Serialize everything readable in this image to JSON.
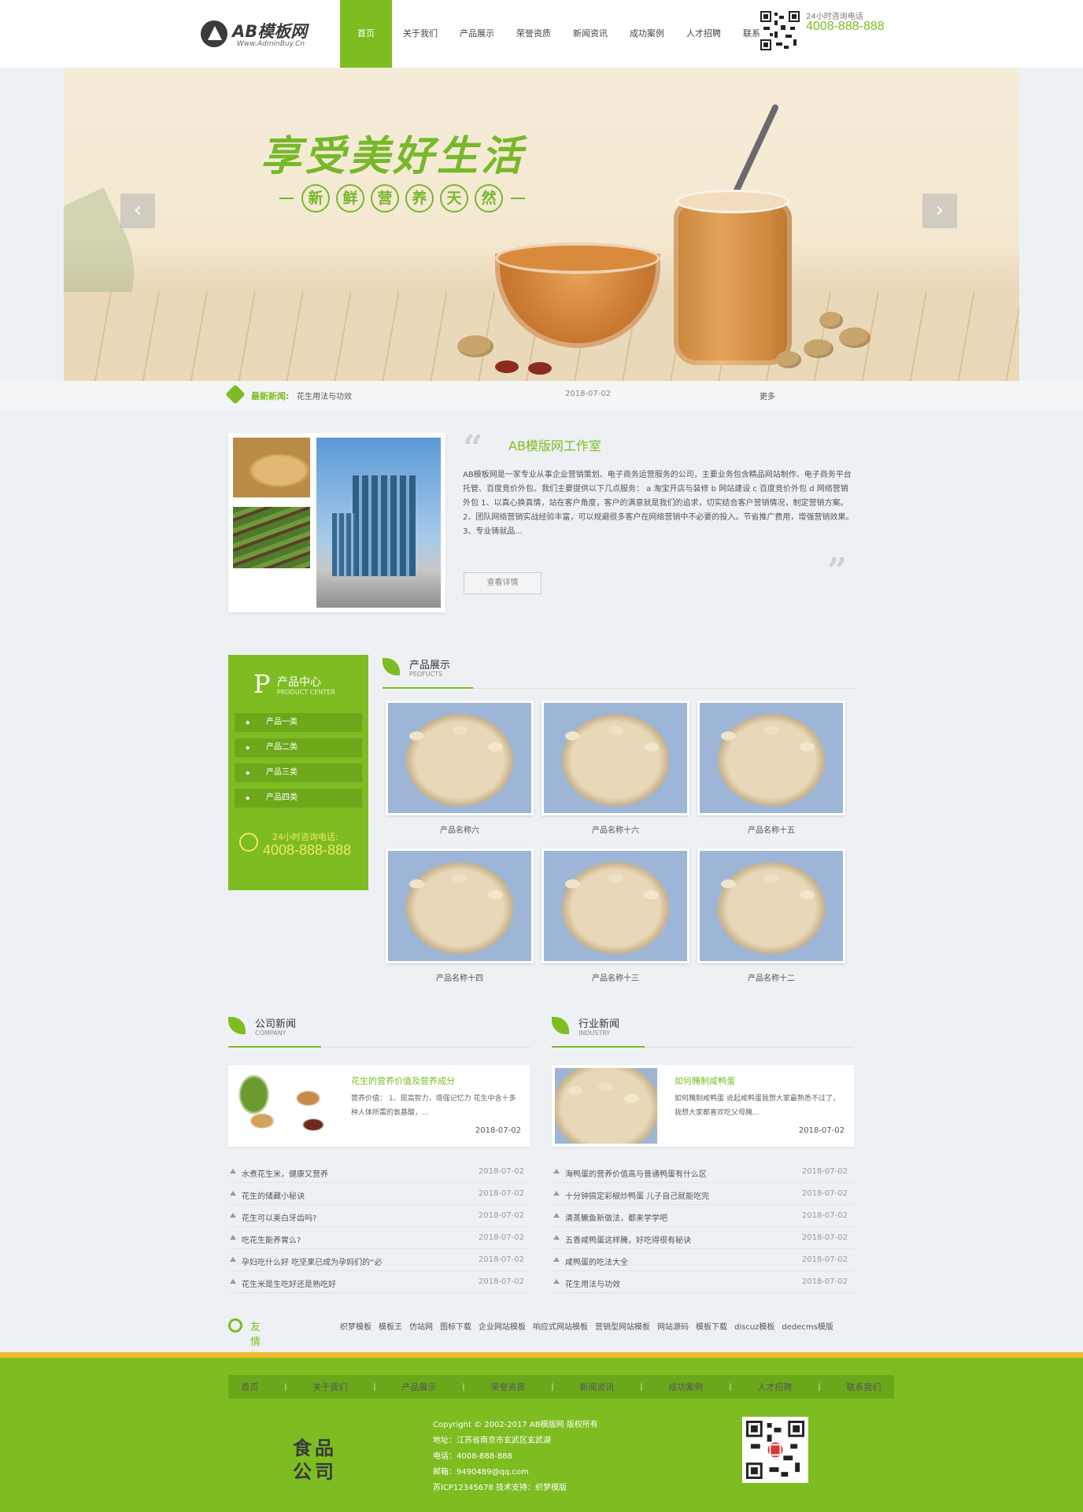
{
  "header": {
    "logo_title": "AB模板网",
    "logo_sub": "Www.AdminBuy.Cn",
    "nav": [
      "首页",
      "关于我们",
      "产品展示",
      "荣誉资质",
      "新闻资讯",
      "成功案例",
      "人才招聘",
      "联系我们"
    ],
    "active_nav": "首页",
    "hotline_label": "24小时咨询电话",
    "hotline": "4008-888-888"
  },
  "banner": {
    "slogan": "享受美好生活",
    "sub_chars": [
      "新",
      "鲜",
      "营",
      "养",
      "天",
      "然"
    ],
    "prev_icon": "chevron-left-icon",
    "next_icon": "chevron-right-icon"
  },
  "ticker": {
    "label": "最新新闻:",
    "title": "花生用法与功效",
    "date": "2018-07-02",
    "more": "更多"
  },
  "about": {
    "title": "AB模版网工作室",
    "text": "AB模板网是一家专业从事企业营销策划、电子商务运营服务的公司，主要业务包含精品网站制作、电子商务平台托管、百度竞价外包、我们主要提供以下几点服务： a 淘宝开店与装修 b 网站建设 c 百度竞价外包 d 网络营销外包 1、以真心换真情，站在客户角度，客户的满意就是我们的追求，切实结合客户营销情况，制定营销方案。 2、团队网络营销实战经验丰富，可以规避很多客户在网络营销中不必要的投入。节省推广费用，增强营销效果。 3、专业铸就品...",
    "button": "查看详情"
  },
  "sidebar": {
    "title": "产品中心",
    "sub": "PRODUCT CENTER",
    "items": [
      "产品一类",
      "产品二类",
      "产品三类",
      "产品四类"
    ],
    "phone_label": "24小时咨询电话:",
    "phone": "4008-888-888"
  },
  "products": {
    "title": "产品展示",
    "sub": "PEOFUCTS",
    "items": [
      "产品名称十六",
      "产品名称十五",
      "产品名称十四",
      "产品名称十三",
      "产品名称十二",
      "产品名称六"
    ]
  },
  "company_news": {
    "title": "公司新闻",
    "sub": "COMPANY",
    "feature_title": "花生的营养价值及营养成分",
    "feature_text": "营养价值： 1、提高智力，增强记忆力 花生中含十多种人体所需的氨基酸，...",
    "feature_date": "2018-07-02",
    "list": [
      {
        "t": "水煮花生米，健康又营养",
        "d": "2018-07-02"
      },
      {
        "t": "花生的储藏小秘诀",
        "d": "2018-07-02"
      },
      {
        "t": "花生可以美白牙齿吗?",
        "d": "2018-07-02"
      },
      {
        "t": "吃花生能养胃么?",
        "d": "2018-07-02"
      },
      {
        "t": "孕妇吃什么好 吃坚果已成为孕妈们的“必",
        "d": "2018-07-02"
      },
      {
        "t": "花生米是生吃好还是熟吃好",
        "d": "2018-07-02"
      }
    ]
  },
  "industry_news": {
    "title": "行业新闻",
    "sub": "INDUSTRY",
    "feature_title": "如何腌制咸鸭蛋",
    "feature_text": "如何腌制咸鸭蛋 说起咸鸭蛋我想大家最熟悉不过了，我想大家都喜欢吃父母腌...",
    "feature_date": "2018-07-02",
    "list": [
      {
        "t": "海鸭蛋的营养价值高与普通鸭蛋有什么区",
        "d": "2018-07-02"
      },
      {
        "t": "十分钟搞定彩椒炒鸭蛋 儿子自己就能吃完",
        "d": "2018-07-02"
      },
      {
        "t": "清蒸鳜鱼新做法，都来学学吧",
        "d": "2018-07-02"
      },
      {
        "t": "五香咸鸭蛋这样腌，好吃得很有秘诀",
        "d": "2018-07-02"
      },
      {
        "t": "咸鸭蛋的吃法大全",
        "d": "2018-07-02"
      },
      {
        "t": "花生用法与功效",
        "d": "2018-07-02"
      }
    ]
  },
  "links": {
    "label": "友情链接",
    "items": [
      "织梦模板",
      "模板王",
      "仿站网",
      "图标下载",
      "企业网站模板",
      "响应式网站模板",
      "营销型网站模板",
      "网站源码",
      "模板下载",
      "discuz模板",
      "dedecms模版"
    ]
  },
  "footer": {
    "nav": [
      "首页",
      "关于我们",
      "产品展示",
      "荣誉资质",
      "新闻资讯",
      "成功案例",
      "人才招聘",
      "联系我们"
    ],
    "logo_text": "食品公司",
    "copyright": "Copyright © 2002-2017 AB模版网 版权所有",
    "address": "地址：江苏省南京市玄武区玄武湖",
    "phone": "电话：4008-888-888",
    "email": "邮箱：9490489@qq.com",
    "icp": "苏ICP12345678   技术支持：织梦模版"
  },
  "colors": {
    "accent": "#7dbd22",
    "stripe": "#f3b72b"
  }
}
